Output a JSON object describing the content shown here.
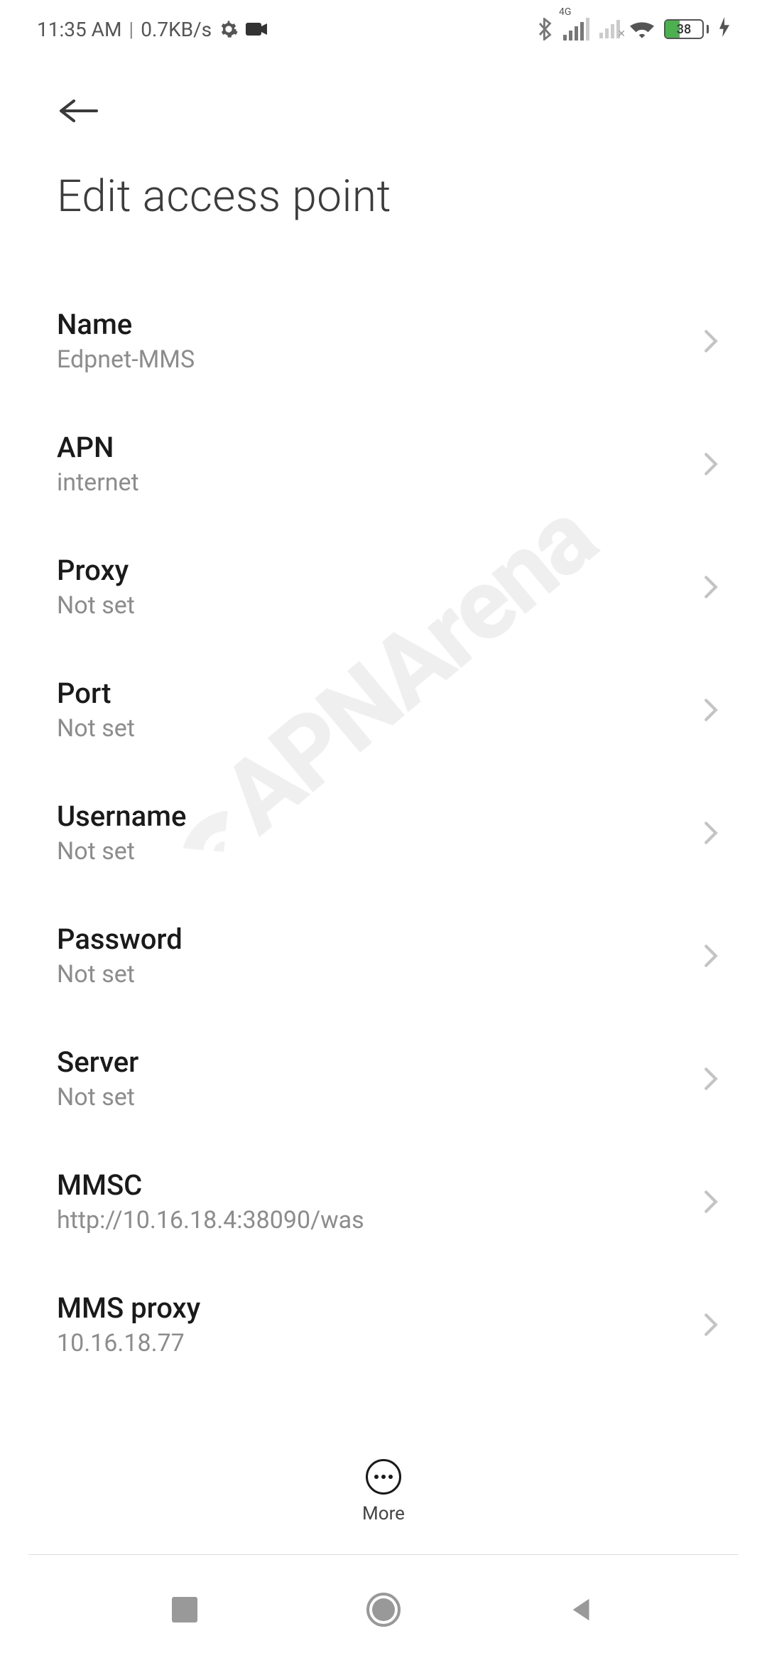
{
  "status": {
    "time": "11:35 AM",
    "rate": "0.7KB/s",
    "battery_pct": "38"
  },
  "header": {
    "title": "Edit access point"
  },
  "settings": [
    {
      "label": "Name",
      "value": "Edpnet-MMS"
    },
    {
      "label": "APN",
      "value": "internet"
    },
    {
      "label": "Proxy",
      "value": "Not set"
    },
    {
      "label": "Port",
      "value": "Not set"
    },
    {
      "label": "Username",
      "value": "Not set"
    },
    {
      "label": "Password",
      "value": "Not set"
    },
    {
      "label": "Server",
      "value": "Not set"
    },
    {
      "label": "MMSC",
      "value": "http://10.16.18.4:38090/was"
    },
    {
      "label": "MMS proxy",
      "value": "10.16.18.77"
    }
  ],
  "bottom": {
    "more_label": "More"
  },
  "watermark": {
    "text": "APNArena"
  }
}
